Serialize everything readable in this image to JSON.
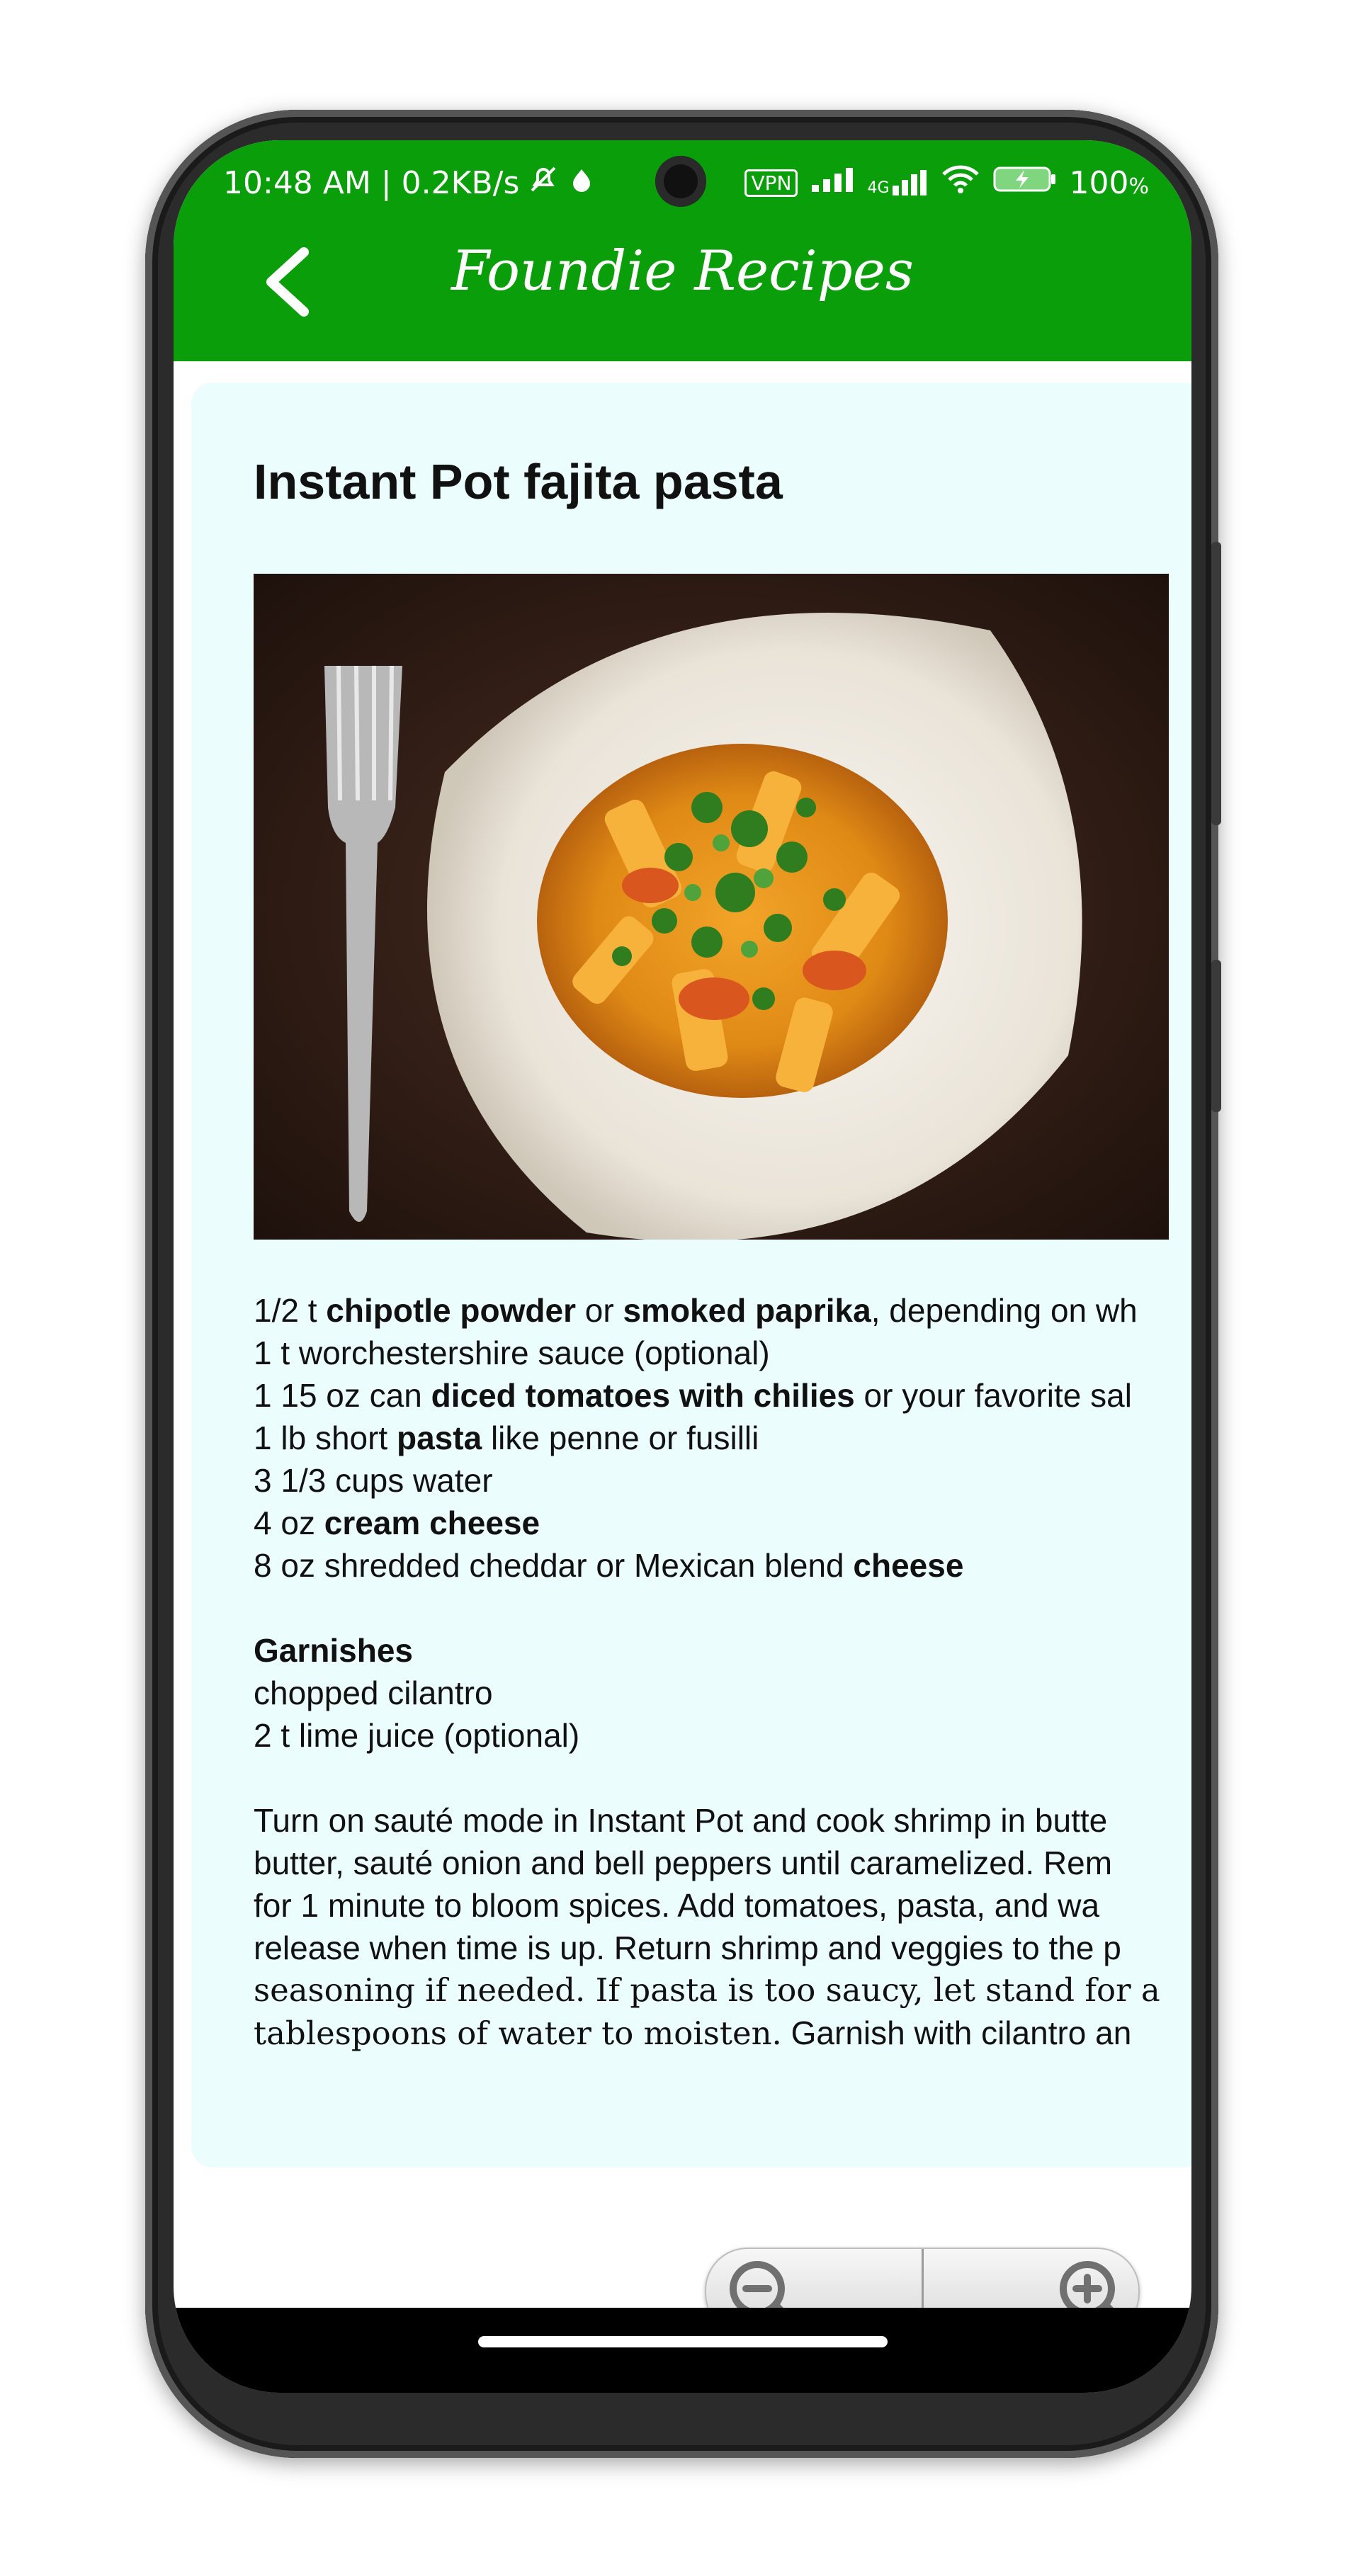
{
  "status_bar": {
    "time_speed": "10:48 AM | 0.2KB/s",
    "vpn": "VPN",
    "network": "4G",
    "battery": "100"
  },
  "app_bar": {
    "title": "Foundie Recipes",
    "color": "#0a9f0a"
  },
  "recipe": {
    "title": "Instant Pot fajita pasta",
    "ingredients": [
      [
        {
          "t": "1/2 t "
        },
        {
          "t": "chipotle powder",
          "b": true
        },
        {
          "t": " or "
        },
        {
          "t": "smoked paprika",
          "b": true
        },
        {
          "t": ", depending on wh"
        }
      ],
      [
        {
          "t": "1 t worchestershire sauce (optional)"
        }
      ],
      [
        {
          "t": "1 15 oz can "
        },
        {
          "t": "diced tomatoes with chilies",
          "b": true
        },
        {
          "t": " or your favorite sal"
        }
      ],
      [
        {
          "t": "1 lb short "
        },
        {
          "t": "pasta",
          "b": true
        },
        {
          "t": " like penne or fusilli"
        }
      ],
      [
        {
          "t": "3 1/3 cups water"
        }
      ],
      [
        {
          "t": "4 oz "
        },
        {
          "t": "cream cheese",
          "b": true
        }
      ],
      [
        {
          "t": "8 oz shredded cheddar or Mexican blend "
        },
        {
          "t": "cheese",
          "b": true
        }
      ]
    ],
    "garnishes_heading": "Garnishes",
    "garnishes": [
      "chopped cilantro",
      "2 t lime juice (optional)"
    ],
    "instructions": [
      "Turn on sauté mode in Instant Pot and cook shrimp in butte",
      "butter, sauté onion and bell peppers until caramelized. Rem",
      "for 1 minute to bloom spices. Add tomatoes, pasta, and wa",
      "release when time is up. Return shrimp and veggies to the p"
    ],
    "instructions_serif_1": "seasoning if needed. If pasta is too saucy, let stand for a",
    "instructions_line_6_prefix": "tablespoons of water to moisten.",
    "instructions_line_6_rest": " Garnish with cilantro an"
  },
  "icons": {
    "back": "back-arrow-icon",
    "zoom_out": "zoom-out-icon",
    "zoom_in": "zoom-in-icon"
  },
  "colors": {
    "card_bg": "#ecfdfd",
    "accent": "#0a9f0a"
  }
}
